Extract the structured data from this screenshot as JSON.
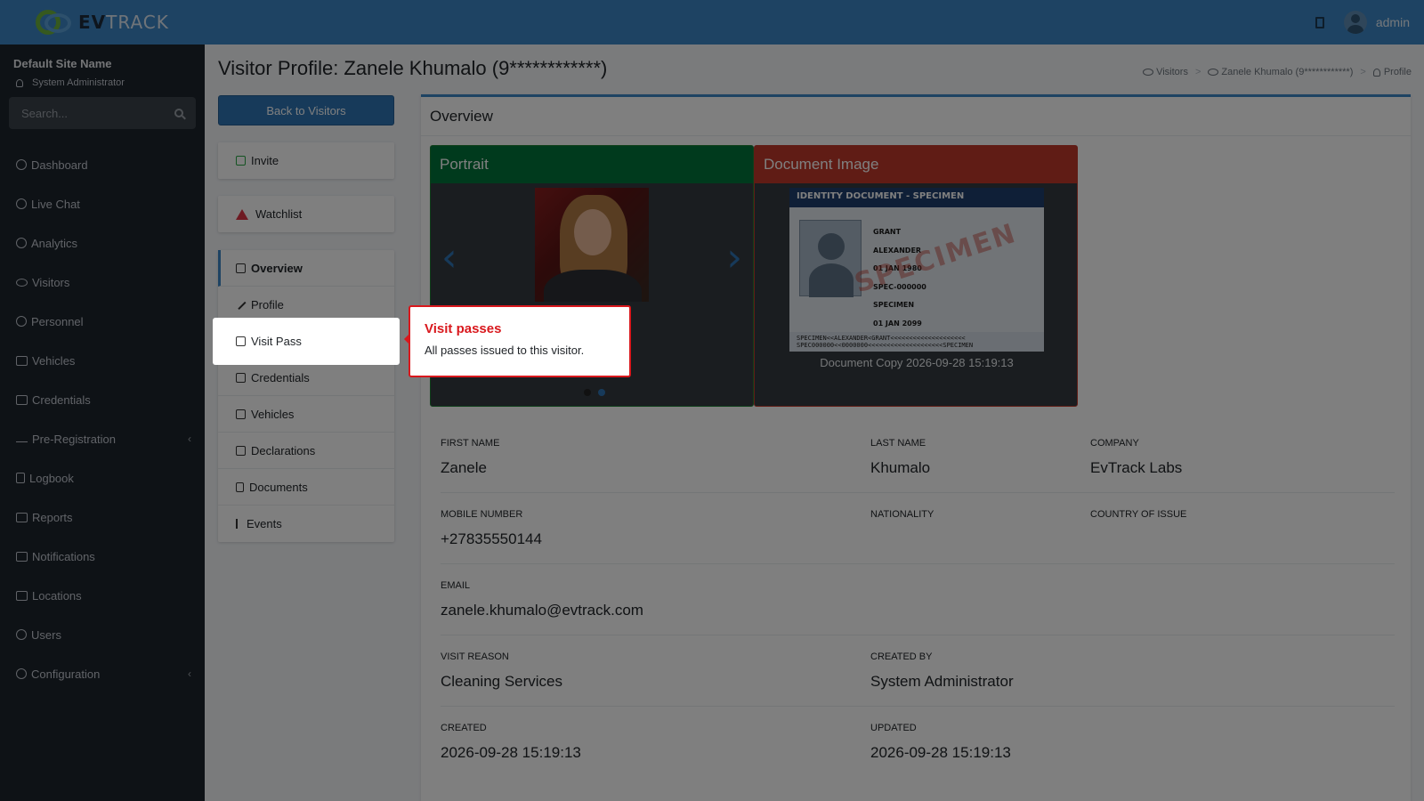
{
  "app": {
    "brand_prefix": "EV",
    "brand_suffix": "TRACK",
    "user": "admin"
  },
  "sidebar": {
    "site_name": "Default Site Name",
    "role": "System Administrator",
    "search_placeholder": "Search...",
    "items": [
      {
        "label": "Dashboard"
      },
      {
        "label": "Live Chat"
      },
      {
        "label": "Analytics"
      },
      {
        "label": "Visitors"
      },
      {
        "label": "Personnel"
      },
      {
        "label": "Vehicles"
      },
      {
        "label": "Credentials"
      },
      {
        "label": "Pre-Registration"
      },
      {
        "label": "Logbook"
      },
      {
        "label": "Reports"
      },
      {
        "label": "Notifications"
      },
      {
        "label": "Locations"
      },
      {
        "label": "Users"
      },
      {
        "label": "Configuration"
      }
    ]
  },
  "page": {
    "title": "Visitor Profile: Zanele Khumalo (9************)",
    "back_label": "Back to Visitors",
    "breadcrumb": [
      "Visitors",
      "Zanele Khumalo (9************)",
      "Profile"
    ]
  },
  "actions": {
    "invite": "Invite",
    "watchlist": "Watchlist"
  },
  "menu": {
    "overview": "Overview",
    "profile": "Profile",
    "visit_pass": "Visit Pass",
    "credentials": "Credentials",
    "vehicles": "Vehicles",
    "declarations": "Declarations",
    "documents": "Documents",
    "events": "Events"
  },
  "overview": {
    "header": "Overview",
    "portrait_title": "Portrait",
    "document_title": "Document Image",
    "document_caption": "Document Copy 2026-09-28 15:19:13",
    "doc_image": {
      "banner": "IDENTITY DOCUMENT - SPECIMEN",
      "values": [
        "GRANT",
        "ALEXANDER",
        "01 JAN 1980",
        "SPEC-000000",
        "SPECIMEN",
        "01 JAN 2099"
      ],
      "stamp": "SPECIMEN",
      "mrz1": "SPECIMEN<<ALEXANDER<GRANT<<<<<<<<<<<<<<<<<<<<",
      "mrz2": "SPEC000000<<0000000<<<<<<<<<<<<<<<<<<<<SPECIMEN"
    },
    "fields": {
      "first_name": {
        "label": "FIRST NAME",
        "value": "Zanele"
      },
      "last_name": {
        "label": "LAST NAME",
        "value": "Khumalo"
      },
      "company": {
        "label": "COMPANY",
        "value": "EvTrack Labs"
      },
      "mobile": {
        "label": "MOBILE NUMBER",
        "value": "+27835550144"
      },
      "nationality": {
        "label": "NATIONALITY",
        "value": ""
      },
      "country_issue": {
        "label": "COUNTRY OF ISSUE",
        "value": ""
      },
      "email": {
        "label": "EMAIL",
        "value": "zanele.khumalo@evtrack.com"
      },
      "visit_reason": {
        "label": "VISIT REASON",
        "value": "Cleaning Services"
      },
      "created_by": {
        "label": "CREATED BY",
        "value": "System Administrator"
      },
      "created": {
        "label": "CREATED",
        "value": "2026-09-28 15:19:13"
      },
      "updated": {
        "label": "UPDATED",
        "value": "2026-09-28 15:19:13"
      }
    }
  },
  "tooltip": {
    "title": "Visit passes",
    "body": "All passes issued to this visitor."
  }
}
